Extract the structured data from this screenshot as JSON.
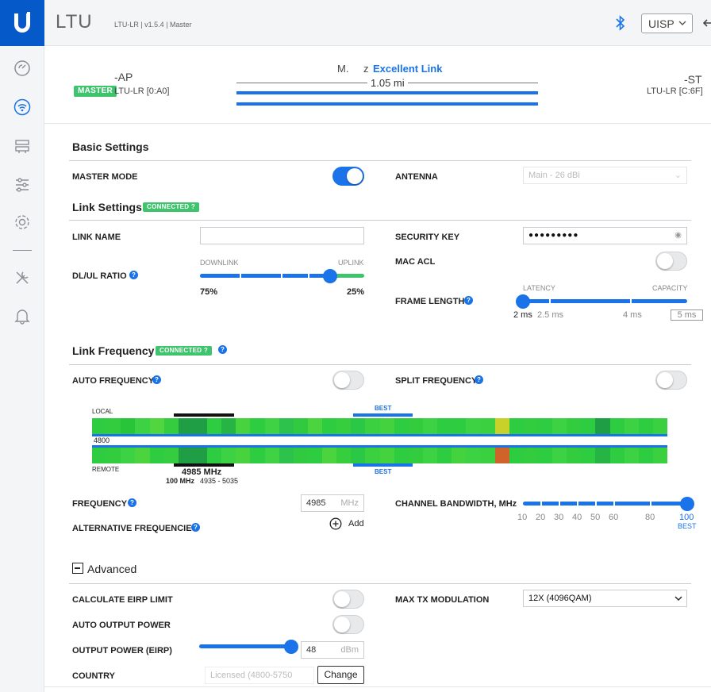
{
  "header": {
    "app_name": "LTU",
    "version": "LTU-LR | v1.5.4 | Master",
    "uisp_label": "UISP"
  },
  "link": {
    "local_name": "-AP",
    "local_role": "MASTER",
    "local_model": "LTU-LR [0:A0]",
    "remote_name": "-ST",
    "remote_model": "LTU-LR [C:6F]",
    "status_prefix": "M.",
    "status_suffix": "z",
    "status": "Excellent Link",
    "distance": "1.05 mi"
  },
  "basic": {
    "title": "Basic Settings",
    "master_mode": "MASTER MODE",
    "antenna": "ANTENNA",
    "antenna_value": "Main - 26 dBi"
  },
  "link_settings": {
    "title": "Link Settings",
    "badge": "CONNECTED ?",
    "link_name": "LINK NAME",
    "security_key": "SECURITY KEY",
    "security_value": "●●●●●●●●●",
    "mac_acl": "MAC ACL",
    "dlul": "DL/UL RATIO",
    "downlink": "DOWNLINK",
    "uplink": "UPLINK",
    "dl_value": "75%",
    "ul_value": "25%",
    "dl_fraction": 0.75,
    "frame_length": "FRAME LENGTH",
    "latency": "LATENCY",
    "capacity": "CAPACITY",
    "frame_options": [
      "2 ms",
      "2.5 ms",
      "4 ms",
      "5 ms"
    ]
  },
  "link_frequency": {
    "title": "Link Frequency",
    "badge": "CONNECTED ?",
    "auto_freq": "AUTO FREQUENCY",
    "split_freq": "SPLIT FREQUENCY",
    "local": "LOCAL",
    "remote": "REMOTE",
    "best": "BEST",
    "axis_start": "4800",
    "center": "4985 MHz",
    "range_bw": "100 MHz",
    "range": "4935 - 5035",
    "frequency": "FREQUENCY",
    "freq_value": "4985",
    "freq_unit": "MHz",
    "alt_freq": "ALTERNATIVE FREQUENCIES",
    "add": "Add",
    "channel_bw": "CHANNEL BANDWIDTH, MHz",
    "bw_options": [
      "10",
      "20",
      "30",
      "40",
      "50",
      "60",
      "80",
      "100"
    ],
    "bw_best": "BEST"
  },
  "advanced": {
    "title": "Advanced",
    "eirp_limit": "CALCULATE EIRP LIMIT",
    "auto_power": "AUTO OUTPUT POWER",
    "output_power": "OUTPUT POWER (EIRP)",
    "power_value": "48",
    "power_unit": "dBm",
    "country": "COUNTRY",
    "country_value": "Licensed (4800-5750",
    "change": "Change",
    "max_tx": "MAX TX MODULATION",
    "max_tx_value": "12X (4096QAM)"
  },
  "colors": {
    "accent": "#1a73e8",
    "brand": "#0559c9",
    "success": "#3ec46d"
  },
  "spectrum": {
    "local": [
      "#2ecc40",
      "#33cc3f",
      "#28c43a",
      "#3dd144",
      "#52d640",
      "#35cc3f",
      "#1f9e46",
      "#1f9e46",
      "#2ecc40",
      "#26b544",
      "#48d23e",
      "#2ecc40",
      "#3ed244",
      "#2cc24c",
      "#30c93f",
      "#4cd43f",
      "#2ecc40",
      "#37ce3e",
      "#2bc746",
      "#3bd040",
      "#45d23f",
      "#2ecc40",
      "#33cc3f",
      "#3dd144",
      "#2ecc40",
      "#2ecc40",
      "#3dd144",
      "#3bd040",
      "#c8d12a",
      "#2ecc40",
      "#33cc3f",
      "#2ecc40",
      "#3dd144",
      "#33cc3f",
      "#2ecc40",
      "#1f9e46",
      "#2ecc40",
      "#3dd144",
      "#2ecc40",
      "#3bd040"
    ],
    "remote": [
      "#2ecc40",
      "#33cc3f",
      "#3dd144",
      "#4cd43f",
      "#2ecc40",
      "#35cc3f",
      "#1f9e46",
      "#1f9e46",
      "#2ecc40",
      "#3dd144",
      "#48d23e",
      "#2ecc40",
      "#3ed244",
      "#2cc24c",
      "#30c93f",
      "#2ecc40",
      "#4cd43f",
      "#37ce3e",
      "#2bc746",
      "#3bd040",
      "#45d23f",
      "#2ecc40",
      "#33cc3f",
      "#3dd144",
      "#2ecc40",
      "#45d23f",
      "#3dd144",
      "#3bd040",
      "#d0632a",
      "#2ecc40",
      "#33cc3f",
      "#2ecc40",
      "#3dd144",
      "#33cc3f",
      "#2ecc40",
      "#26b544",
      "#2ecc40",
      "#3dd144",
      "#2ecc40",
      "#3bd040"
    ]
  }
}
